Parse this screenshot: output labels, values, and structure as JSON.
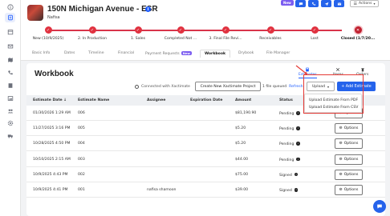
{
  "project": {
    "title": "150N Michigan Avenue - ESR",
    "subtitle": "Nafisa",
    "new_badge": "New",
    "actions_label": "Actions"
  },
  "stages": [
    {
      "label": "New (10/9/2025)",
      "current": false
    },
    {
      "label": "2. In Production",
      "current": false
    },
    {
      "label": "1. Sales",
      "current": false
    },
    {
      "label": "Completed Not ...",
      "current": false
    },
    {
      "label": "3. Final File Revi...",
      "current": false
    },
    {
      "label": "Receivables",
      "current": false
    },
    {
      "label": "Lost",
      "current": false
    },
    {
      "label": "Closed (1/7/20...",
      "current": true
    }
  ],
  "tabs": [
    {
      "label": "Basic Info",
      "active": false
    },
    {
      "label": "Dates",
      "active": false
    },
    {
      "label": "Timeline",
      "active": false
    },
    {
      "label": "Financial",
      "active": false
    },
    {
      "label": "Payment Requests",
      "active": false,
      "badge": "New"
    },
    {
      "label": "Workbook",
      "active": true
    },
    {
      "label": "Drybook",
      "active": false
    },
    {
      "label": "File Manager",
      "active": false
    }
  ],
  "workbook": {
    "title": "Workbook",
    "views": [
      "Estimates",
      "Items",
      "Orders"
    ],
    "active_view": "Estimates",
    "connected_text": "Connected with Xactimate",
    "new_project_label": "Create New Xactimate Project",
    "queued_text": "1 file queued",
    "refresh_label": "Refresh",
    "upload_label": "Upload",
    "add_estimate_label": "+ Add Estimate",
    "upload_options": [
      "Upload Estimate From PDF",
      "Upload Estimate From CSV"
    ]
  },
  "table": {
    "columns": [
      "Estimate Date",
      "Estimate Name",
      "Assignee",
      "Expiration Date",
      "Amount",
      "Status"
    ],
    "options_label": "Options",
    "rows": [
      {
        "date": "01/30/2026 1:29 AM",
        "name": "006",
        "assignee": "",
        "expiration": "",
        "amount": "$81,190.90",
        "status": "Pending"
      },
      {
        "date": "11/27/2025 3:16 PM",
        "name": "005",
        "assignee": "",
        "expiration": "",
        "amount": "$5.20",
        "status": "Pending"
      },
      {
        "date": "10/28/2025 4:50 PM",
        "name": "004",
        "assignee": "",
        "expiration": "",
        "amount": "$5.20",
        "status": "Pending"
      },
      {
        "date": "10/10/2025 2:15 AM",
        "name": "003",
        "assignee": "",
        "expiration": "",
        "amount": "$44.00",
        "status": "Pending"
      },
      {
        "date": "10/9/2025 4:43 PM",
        "name": "002",
        "assignee": "",
        "expiration": "",
        "amount": "$75.00",
        "status": "Signed"
      },
      {
        "date": "10/9/2025 4:41 PM",
        "name": "001",
        "assignee": "nafisa shamoon",
        "expiration": "",
        "amount": "$39.00",
        "status": "Signed"
      }
    ]
  },
  "colors": {
    "accent": "#2563eb",
    "stage_red": "#e0313f",
    "highlight_red": "#e53935",
    "badge_purple": "#7b5cf0"
  }
}
